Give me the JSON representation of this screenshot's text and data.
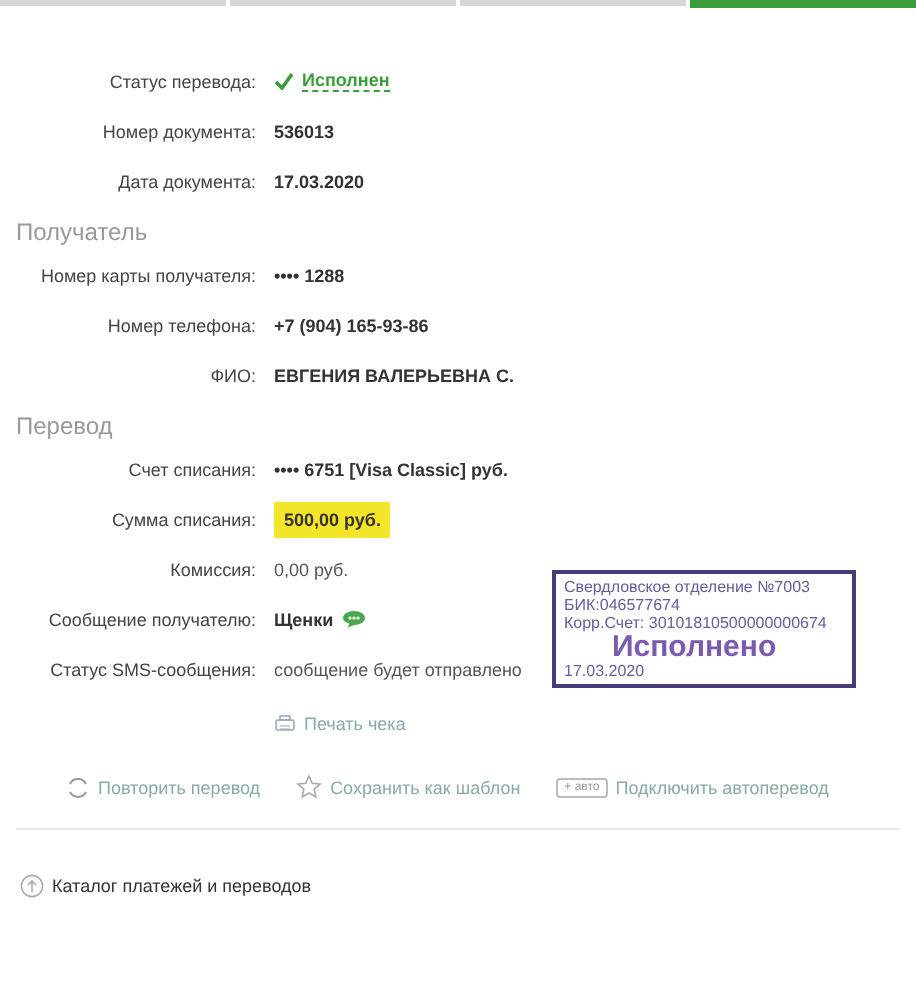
{
  "steps": [
    {
      "selected": false
    },
    {
      "selected": false
    },
    {
      "selected": false
    },
    {
      "selected": true
    }
  ],
  "document": [
    {
      "label": "Статус перевода:",
      "value": "Исполнен",
      "kind": "status"
    },
    {
      "label": "Номер документа:",
      "value": "536013",
      "kind": "bold"
    },
    {
      "label": "Дата документа:",
      "value": "17.03.2020",
      "kind": "bold"
    }
  ],
  "sections": [
    {
      "title": "Получатель",
      "rows": [
        {
          "label": "Номер карты получателя:",
          "value": "•••• 1288",
          "kind": "bold"
        },
        {
          "label": "Номер телефона:",
          "value": "+7 (904) 165-93-86",
          "kind": "bold"
        },
        {
          "label": "ФИО:",
          "value": "ЕВГЕНИЯ ВАЛЕРЬЕВНА С.",
          "kind": "bold"
        }
      ]
    },
    {
      "title": "Перевод",
      "rows": [
        {
          "label": "Счет списания:",
          "value": "•••• 6751  [Visa Classic]  руб.",
          "kind": "bold"
        },
        {
          "label": "Сумма списания:",
          "value": "500,00  руб.",
          "kind": "highlight"
        },
        {
          "label": "Комиссия:",
          "value": "0,00 руб.",
          "kind": "plain"
        },
        {
          "label": "Сообщение получателю:",
          "value": "Щенки",
          "kind": "message"
        },
        {
          "label": "Статус SMS-сообщения:",
          "value": "сообщение будет отправлено",
          "kind": "plain"
        }
      ]
    }
  ],
  "stamp": {
    "lines": [
      "Свердловское отделение №7003",
      "БИК:046577674",
      "Корр.Счет: 30101810500000000674"
    ],
    "status": "Исполнено",
    "date": "17.03.2020"
  },
  "print_link": "Печать чека",
  "actions": [
    {
      "label": "Повторить перевод",
      "kind": "repeat"
    },
    {
      "label": "Сохранить как шаблон",
      "kind": "template"
    },
    {
      "label": "Подключить автоперевод",
      "kind": "auto",
      "badge": "+ авто"
    }
  ],
  "catalog_link": "Каталог платежей и переводов"
}
